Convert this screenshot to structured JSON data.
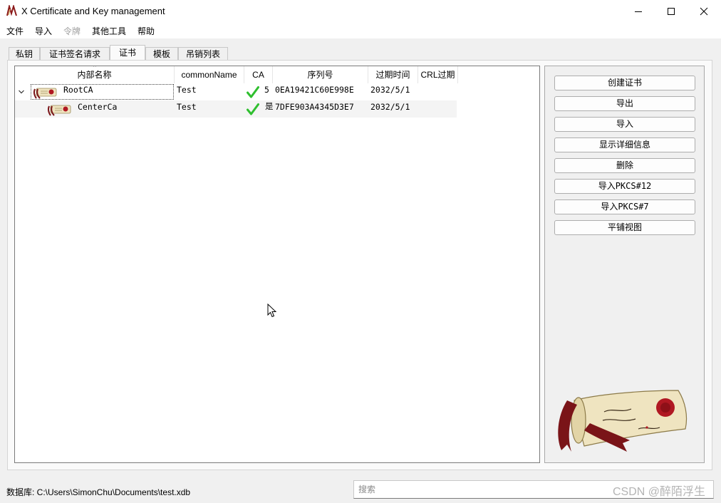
{
  "window": {
    "title": "X Certificate and Key management"
  },
  "menu": [
    "文件",
    "导入",
    "令牌",
    "其他工具",
    "帮助"
  ],
  "tabs": [
    "私钥",
    "证书签名请求",
    "证书",
    "模板",
    "吊销列表"
  ],
  "table": {
    "columns": [
      "内部名称",
      "commonName",
      "CA",
      "序列号",
      "过期时间",
      "CRL过期"
    ],
    "rows": [
      {
        "name": "RootCA",
        "common_name": "Test",
        "ca_check": true,
        "ca_extra": "5",
        "serial": "0EA19421C60E998E",
        "expiry": "2032/5/1",
        "crl": ""
      },
      {
        "name": "CenterCa",
        "common_name": "Test",
        "ca_check": true,
        "ca_extra": "是",
        "serial": "7DFE903A4345D3E7",
        "expiry": "2032/5/1",
        "crl": ""
      }
    ]
  },
  "buttons": [
    "创建证书",
    "导出",
    "导入",
    "显示详细信息",
    "删除",
    "导入PKCS#12",
    "导入PKCS#7",
    "平铺视图"
  ],
  "status": {
    "database": "数据库: C:\\Users\\SimonChu\\Documents\\test.xdb"
  },
  "search": {
    "placeholder": "搜索",
    "value": ""
  },
  "watermark": "CSDN @醉陌浮生",
  "colors": {
    "check_green": "#2fbf2f",
    "wax_red": "#b01822",
    "parchment": "#efe4c0",
    "ribbon": "#7a1418"
  },
  "icons": [
    "app-icon",
    "minimize-icon",
    "maximize-icon",
    "close-icon",
    "chevron-down-icon",
    "certificate-icon",
    "checkmark-icon",
    "certificate-scroll-image",
    "mouse-cursor-icon"
  ]
}
